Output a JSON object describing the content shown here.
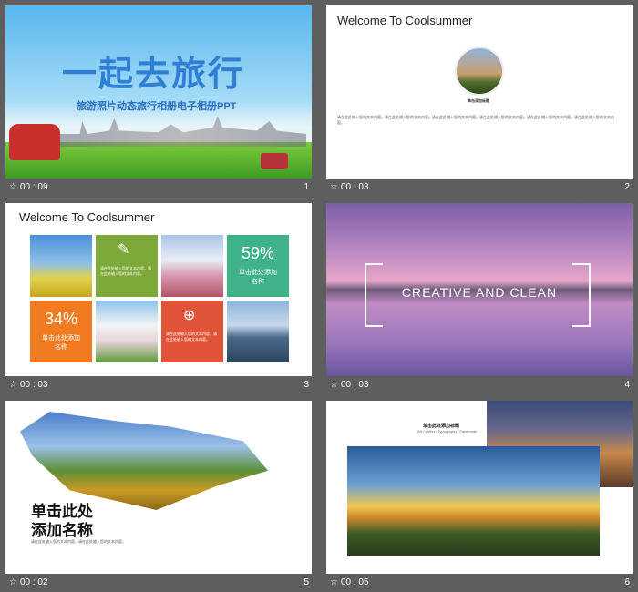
{
  "slides": [
    {
      "time": "00 : 09",
      "num": "1",
      "title": "一起去旅行",
      "subtitle": "旅游照片动态旅行相册电子相册PPT"
    },
    {
      "time": "00 : 03",
      "num": "2",
      "title": "Welcome To Coolsummer",
      "caption": "单击添加标题",
      "body": "请在此处输入您的文本内容。请在此处输入您的文本内容。请在此处输入您的文本内容。请在此处输入您的文本内容。请在此处输入您的文本内容。请在此处输入您的文本内容。"
    },
    {
      "time": "00 : 03",
      "num": "3",
      "title": "Welcome To Coolsummer",
      "pct1": "59%",
      "pct1_label": "单击此处添加名称",
      "pct2": "34%",
      "pct2_label": "单击此处添加名称",
      "block_text": "请在此处输入您的文本内容，请在此处输入您的文本内容。"
    },
    {
      "time": "00 : 03",
      "num": "4",
      "title": "CREATIVE AND CLEAN"
    },
    {
      "time": "00 : 02",
      "num": "5",
      "title_line1": "单击此处",
      "title_line2": "添加名称",
      "body": "请在此处输入您的文本内容，请在此处输入您的文本内容。"
    },
    {
      "time": "00 : 05",
      "num": "6",
      "title": "单击此处添加标题",
      "subtitle": "Art / Writer / Typography / Facemode"
    }
  ],
  "colors": {
    "green": "#7da83a",
    "teal": "#3fb28a",
    "orange": "#f07b21",
    "red": "#e0553a"
  }
}
